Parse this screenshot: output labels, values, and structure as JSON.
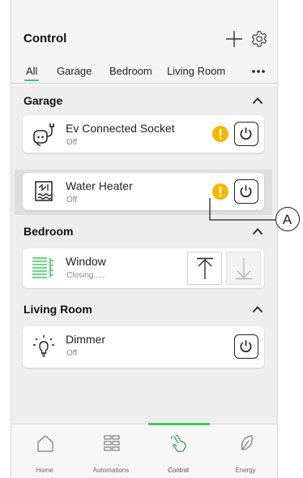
{
  "header": {
    "title": "Control"
  },
  "tabs": [
    {
      "label": "All",
      "active": true
    },
    {
      "label": "Garage"
    },
    {
      "label": "Bedroom"
    },
    {
      "label": "Living Room"
    }
  ],
  "sections": {
    "garage": {
      "title": "Garage",
      "devices": [
        {
          "name": "Ev Connected Socket",
          "status": "Off",
          "icon": "ev-socket-icon",
          "warning": true
        },
        {
          "name": "Water Heater",
          "status": "Off",
          "icon": "water-heater-icon",
          "warning": true
        }
      ]
    },
    "bedroom": {
      "title": "Bedroom",
      "devices": [
        {
          "name": "Window",
          "status": "Closing.....",
          "icon": "blind-icon"
        }
      ]
    },
    "living_room": {
      "title": "Living Room",
      "devices": [
        {
          "name": "Dimmer",
          "status": "Off",
          "icon": "bulb-icon"
        }
      ]
    }
  },
  "nav": [
    {
      "label": "Home",
      "icon": "home-icon"
    },
    {
      "label": "Automations",
      "icon": "grid-icon"
    },
    {
      "label": "Control",
      "icon": "hand-icon",
      "active": true
    },
    {
      "label": "Energy",
      "icon": "leaf-icon"
    }
  ],
  "callout": {
    "label": "A"
  },
  "colors": {
    "accent": "#3dcd58",
    "warning": "#f5b800",
    "background": "#eeeeee"
  }
}
